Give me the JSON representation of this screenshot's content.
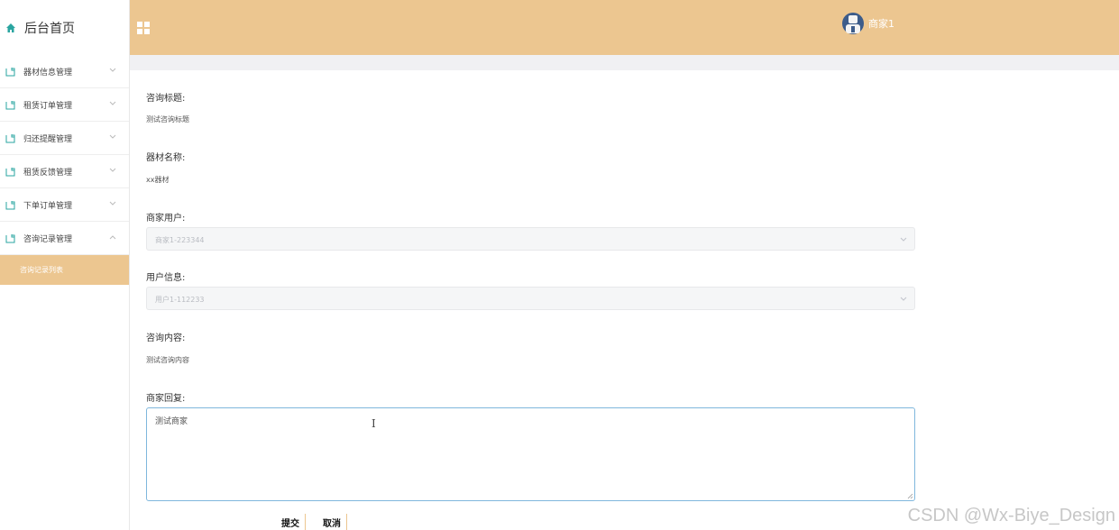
{
  "sidebar": {
    "brand": {
      "icon": "home-icon",
      "title": "后台首页"
    },
    "items": [
      {
        "label": "器材信息管理",
        "icon": "file-icon",
        "expanded": false
      },
      {
        "label": "租赁订单管理",
        "icon": "file-icon",
        "expanded": false
      },
      {
        "label": "归还提醒管理",
        "icon": "file-icon",
        "expanded": false
      },
      {
        "label": "租赁反馈管理",
        "icon": "file-icon",
        "expanded": false
      },
      {
        "label": "下单订单管理",
        "icon": "file-icon",
        "expanded": false
      },
      {
        "label": "咨询记录管理",
        "icon": "file-icon",
        "expanded": true
      }
    ],
    "subitems": [
      {
        "label": "咨询记录列表",
        "active": true
      }
    ]
  },
  "header": {
    "menu_icon": "grid-icon",
    "user": {
      "name": "商家1",
      "avatar": "avatar-icon"
    }
  },
  "form": {
    "title": {
      "label": "咨询标题:",
      "value": "测试咨询标题"
    },
    "equipment": {
      "label": "器材名称:",
      "value": "xx器材"
    },
    "merchant": {
      "label": "商家用户:",
      "value": "商家1-223344"
    },
    "user": {
      "label": "用户信息:",
      "value": "用户1-112233"
    },
    "content": {
      "label": "咨询内容:",
      "value": "测试咨询内容"
    },
    "reply": {
      "label": "商家回复:",
      "value": "测试商家"
    }
  },
  "buttons": {
    "submit": "提交",
    "cancel": "取消"
  },
  "watermark": "CSDN @Wx-Biye_Design",
  "colors": {
    "accent": "#ecc690",
    "sidebar_active": "#ecc690",
    "home_icon": "#2aa5a0"
  }
}
